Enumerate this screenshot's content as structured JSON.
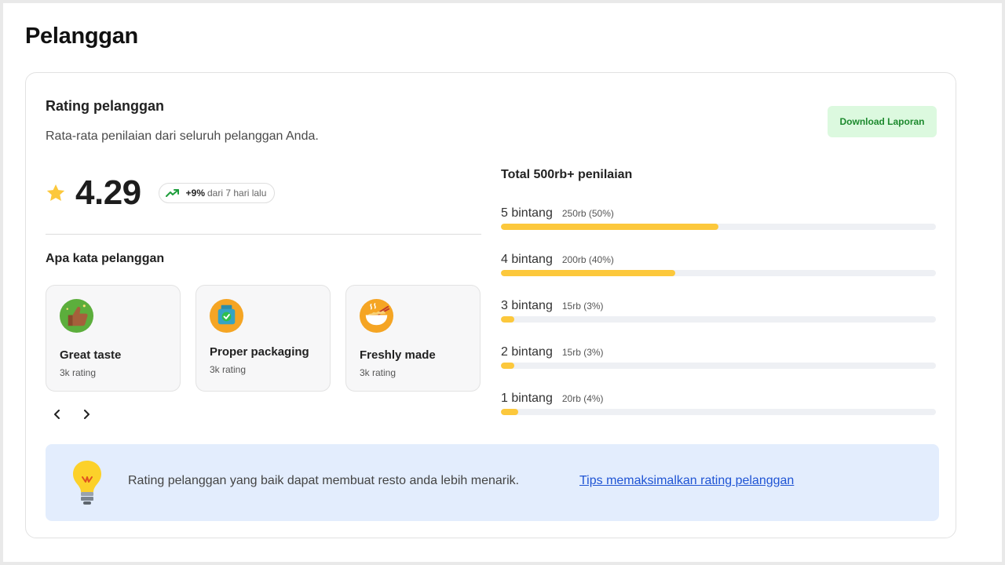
{
  "page": {
    "title": "Pelanggan"
  },
  "rating_card": {
    "title": "Rating pelanggan",
    "subtitle": "Rata-rata penilaian dari seluruh pelanggan Anda.",
    "download_label": "Download Laporan",
    "score": "4.29",
    "trend": {
      "percent": "+9%",
      "period": "dari 7 hari lalu"
    },
    "feedback_heading": "Apa kata pelanggan",
    "feedback_items": [
      {
        "label": "Great taste",
        "count": "3k rating",
        "icon": "thumbs-up-icon"
      },
      {
        "label": "Proper packaging",
        "count": "3k rating",
        "icon": "package-icon"
      },
      {
        "label": "Freshly made",
        "count": "3k rating",
        "icon": "noodle-bowl-icon"
      }
    ],
    "total_label": "Total 500rb+ penilaian",
    "distribution": [
      {
        "label": "5 bintang",
        "count": "250rb (50%)",
        "fraction": 0.5
      },
      {
        "label": "4 bintang",
        "count": "200rb (40%)",
        "fraction": 0.4
      },
      {
        "label": "3 bintang",
        "count": "15rb (3%)",
        "fraction": 0.03
      },
      {
        "label": "2 bintang",
        "count": "15rb (3%)",
        "fraction": 0.03
      },
      {
        "label": "1 bintang",
        "count": "20rb (4%)",
        "fraction": 0.04
      }
    ]
  },
  "tip": {
    "text": "Rating pelanggan yang baik dapat membuat resto anda lebih menarik.",
    "link_text": "Tips memaksimalkan rating pelanggan"
  },
  "colors": {
    "accent_bar": "#fcc83c",
    "download_bg": "#dcf9df",
    "download_text": "#1d8a2e",
    "tip_bg": "#e3edfd",
    "link": "#1f54d4",
    "trend_up": "#1e9e3c"
  }
}
